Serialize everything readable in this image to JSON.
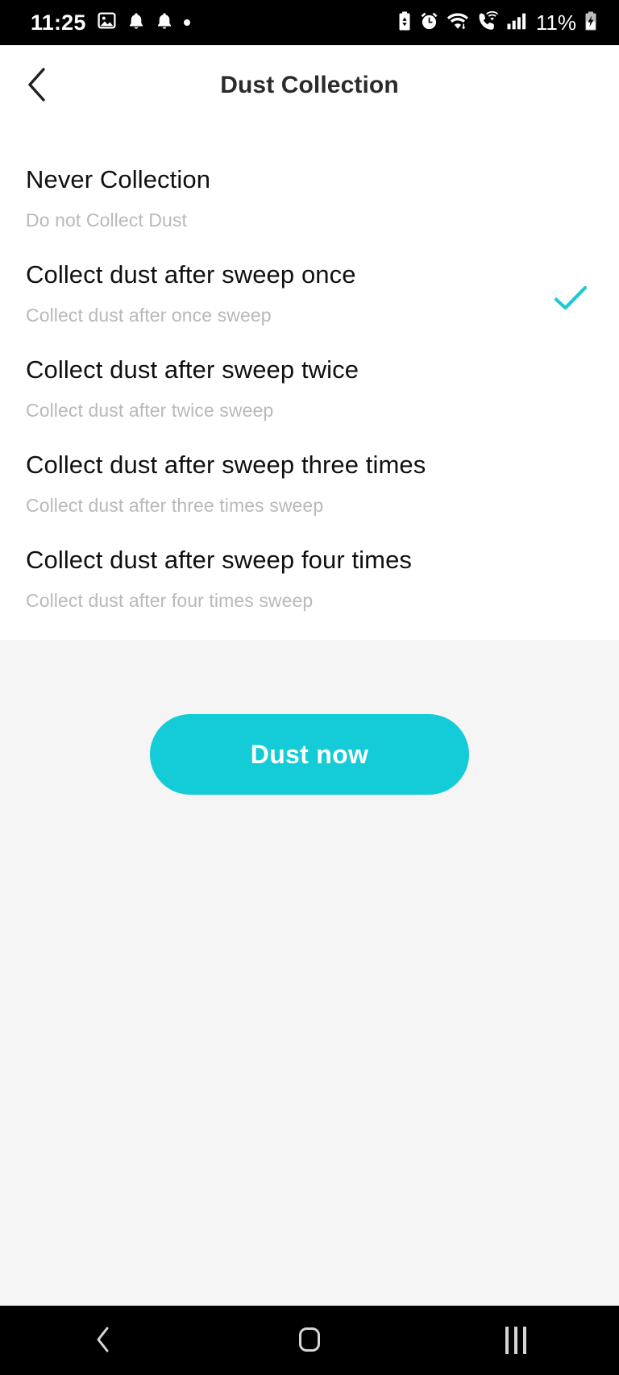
{
  "status_bar": {
    "time": "11:25",
    "battery_percent": "11%",
    "left_icons": [
      "photo-icon",
      "notification-bell-icon",
      "notification-bell-icon",
      "dot-indicator-icon"
    ],
    "right_icons": [
      "battery-saver-icon",
      "alarm-clock-icon",
      "wifi-icon",
      "wifi-calling-icon",
      "signal-bars-icon",
      "battery-charging-icon"
    ]
  },
  "header": {
    "title": "Dust Collection",
    "back_icon": "chevron-left-icon"
  },
  "colors": {
    "accent": "#14cbd8",
    "check": "#1ec9d6",
    "title_text": "#101010",
    "subtitle_text": "#b9b9b9",
    "panel_bg": "#f5f5f5"
  },
  "options": [
    {
      "title": "Never Collection",
      "subtitle": "Do not Collect Dust",
      "selected": false
    },
    {
      "title": "Collect dust after sweep once",
      "subtitle": "Collect dust after once sweep",
      "selected": true
    },
    {
      "title": "Collect dust after sweep twice",
      "subtitle": "Collect dust after twice sweep",
      "selected": false
    },
    {
      "title": "Collect dust after sweep three times",
      "subtitle": "Collect dust after three times sweep",
      "selected": false
    },
    {
      "title": "Collect dust after sweep four times",
      "subtitle": "Collect dust after four times sweep",
      "selected": false
    }
  ],
  "action": {
    "dust_now_label": "Dust now"
  },
  "nav_bar": {
    "back_icon": "chevron-left-icon",
    "home_icon": "home-square-icon",
    "recents_icon": "recents-bars-icon"
  }
}
